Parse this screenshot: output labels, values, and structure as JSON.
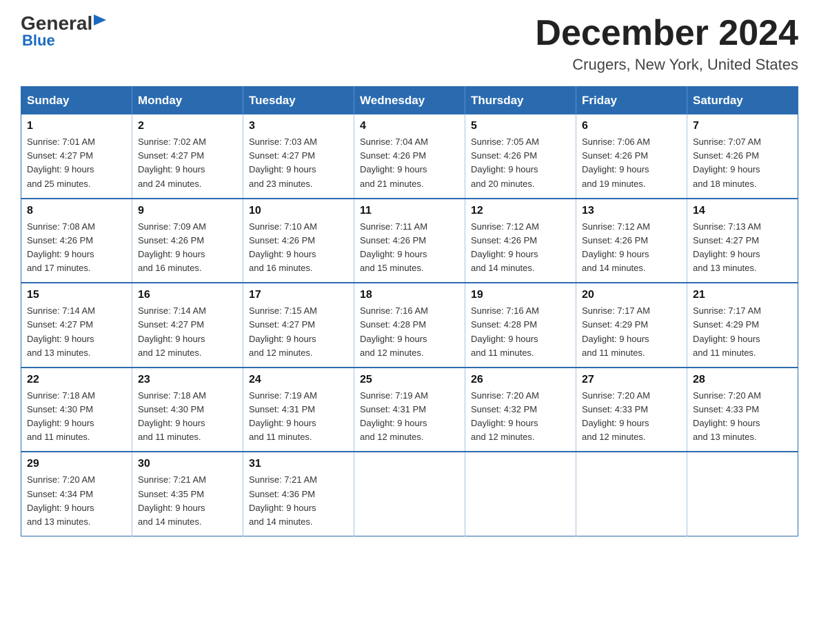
{
  "header": {
    "logo_line1": "General",
    "logo_line2": "Blue",
    "main_title": "December 2024",
    "subtitle": "Crugers, New York, United States"
  },
  "calendar": {
    "days_of_week": [
      "Sunday",
      "Monday",
      "Tuesday",
      "Wednesday",
      "Thursday",
      "Friday",
      "Saturday"
    ],
    "weeks": [
      [
        {
          "day": "1",
          "info": "Sunrise: 7:01 AM\nSunset: 4:27 PM\nDaylight: 9 hours\nand 25 minutes."
        },
        {
          "day": "2",
          "info": "Sunrise: 7:02 AM\nSunset: 4:27 PM\nDaylight: 9 hours\nand 24 minutes."
        },
        {
          "day": "3",
          "info": "Sunrise: 7:03 AM\nSunset: 4:27 PM\nDaylight: 9 hours\nand 23 minutes."
        },
        {
          "day": "4",
          "info": "Sunrise: 7:04 AM\nSunset: 4:26 PM\nDaylight: 9 hours\nand 21 minutes."
        },
        {
          "day": "5",
          "info": "Sunrise: 7:05 AM\nSunset: 4:26 PM\nDaylight: 9 hours\nand 20 minutes."
        },
        {
          "day": "6",
          "info": "Sunrise: 7:06 AM\nSunset: 4:26 PM\nDaylight: 9 hours\nand 19 minutes."
        },
        {
          "day": "7",
          "info": "Sunrise: 7:07 AM\nSunset: 4:26 PM\nDaylight: 9 hours\nand 18 minutes."
        }
      ],
      [
        {
          "day": "8",
          "info": "Sunrise: 7:08 AM\nSunset: 4:26 PM\nDaylight: 9 hours\nand 17 minutes."
        },
        {
          "day": "9",
          "info": "Sunrise: 7:09 AM\nSunset: 4:26 PM\nDaylight: 9 hours\nand 16 minutes."
        },
        {
          "day": "10",
          "info": "Sunrise: 7:10 AM\nSunset: 4:26 PM\nDaylight: 9 hours\nand 16 minutes."
        },
        {
          "day": "11",
          "info": "Sunrise: 7:11 AM\nSunset: 4:26 PM\nDaylight: 9 hours\nand 15 minutes."
        },
        {
          "day": "12",
          "info": "Sunrise: 7:12 AM\nSunset: 4:26 PM\nDaylight: 9 hours\nand 14 minutes."
        },
        {
          "day": "13",
          "info": "Sunrise: 7:12 AM\nSunset: 4:26 PM\nDaylight: 9 hours\nand 14 minutes."
        },
        {
          "day": "14",
          "info": "Sunrise: 7:13 AM\nSunset: 4:27 PM\nDaylight: 9 hours\nand 13 minutes."
        }
      ],
      [
        {
          "day": "15",
          "info": "Sunrise: 7:14 AM\nSunset: 4:27 PM\nDaylight: 9 hours\nand 13 minutes."
        },
        {
          "day": "16",
          "info": "Sunrise: 7:14 AM\nSunset: 4:27 PM\nDaylight: 9 hours\nand 12 minutes."
        },
        {
          "day": "17",
          "info": "Sunrise: 7:15 AM\nSunset: 4:27 PM\nDaylight: 9 hours\nand 12 minutes."
        },
        {
          "day": "18",
          "info": "Sunrise: 7:16 AM\nSunset: 4:28 PM\nDaylight: 9 hours\nand 12 minutes."
        },
        {
          "day": "19",
          "info": "Sunrise: 7:16 AM\nSunset: 4:28 PM\nDaylight: 9 hours\nand 11 minutes."
        },
        {
          "day": "20",
          "info": "Sunrise: 7:17 AM\nSunset: 4:29 PM\nDaylight: 9 hours\nand 11 minutes."
        },
        {
          "day": "21",
          "info": "Sunrise: 7:17 AM\nSunset: 4:29 PM\nDaylight: 9 hours\nand 11 minutes."
        }
      ],
      [
        {
          "day": "22",
          "info": "Sunrise: 7:18 AM\nSunset: 4:30 PM\nDaylight: 9 hours\nand 11 minutes."
        },
        {
          "day": "23",
          "info": "Sunrise: 7:18 AM\nSunset: 4:30 PM\nDaylight: 9 hours\nand 11 minutes."
        },
        {
          "day": "24",
          "info": "Sunrise: 7:19 AM\nSunset: 4:31 PM\nDaylight: 9 hours\nand 11 minutes."
        },
        {
          "day": "25",
          "info": "Sunrise: 7:19 AM\nSunset: 4:31 PM\nDaylight: 9 hours\nand 12 minutes."
        },
        {
          "day": "26",
          "info": "Sunrise: 7:20 AM\nSunset: 4:32 PM\nDaylight: 9 hours\nand 12 minutes."
        },
        {
          "day": "27",
          "info": "Sunrise: 7:20 AM\nSunset: 4:33 PM\nDaylight: 9 hours\nand 12 minutes."
        },
        {
          "day": "28",
          "info": "Sunrise: 7:20 AM\nSunset: 4:33 PM\nDaylight: 9 hours\nand 13 minutes."
        }
      ],
      [
        {
          "day": "29",
          "info": "Sunrise: 7:20 AM\nSunset: 4:34 PM\nDaylight: 9 hours\nand 13 minutes."
        },
        {
          "day": "30",
          "info": "Sunrise: 7:21 AM\nSunset: 4:35 PM\nDaylight: 9 hours\nand 14 minutes."
        },
        {
          "day": "31",
          "info": "Sunrise: 7:21 AM\nSunset: 4:36 PM\nDaylight: 9 hours\nand 14 minutes."
        },
        {
          "day": "",
          "info": ""
        },
        {
          "day": "",
          "info": ""
        },
        {
          "day": "",
          "info": ""
        },
        {
          "day": "",
          "info": ""
        }
      ]
    ]
  }
}
